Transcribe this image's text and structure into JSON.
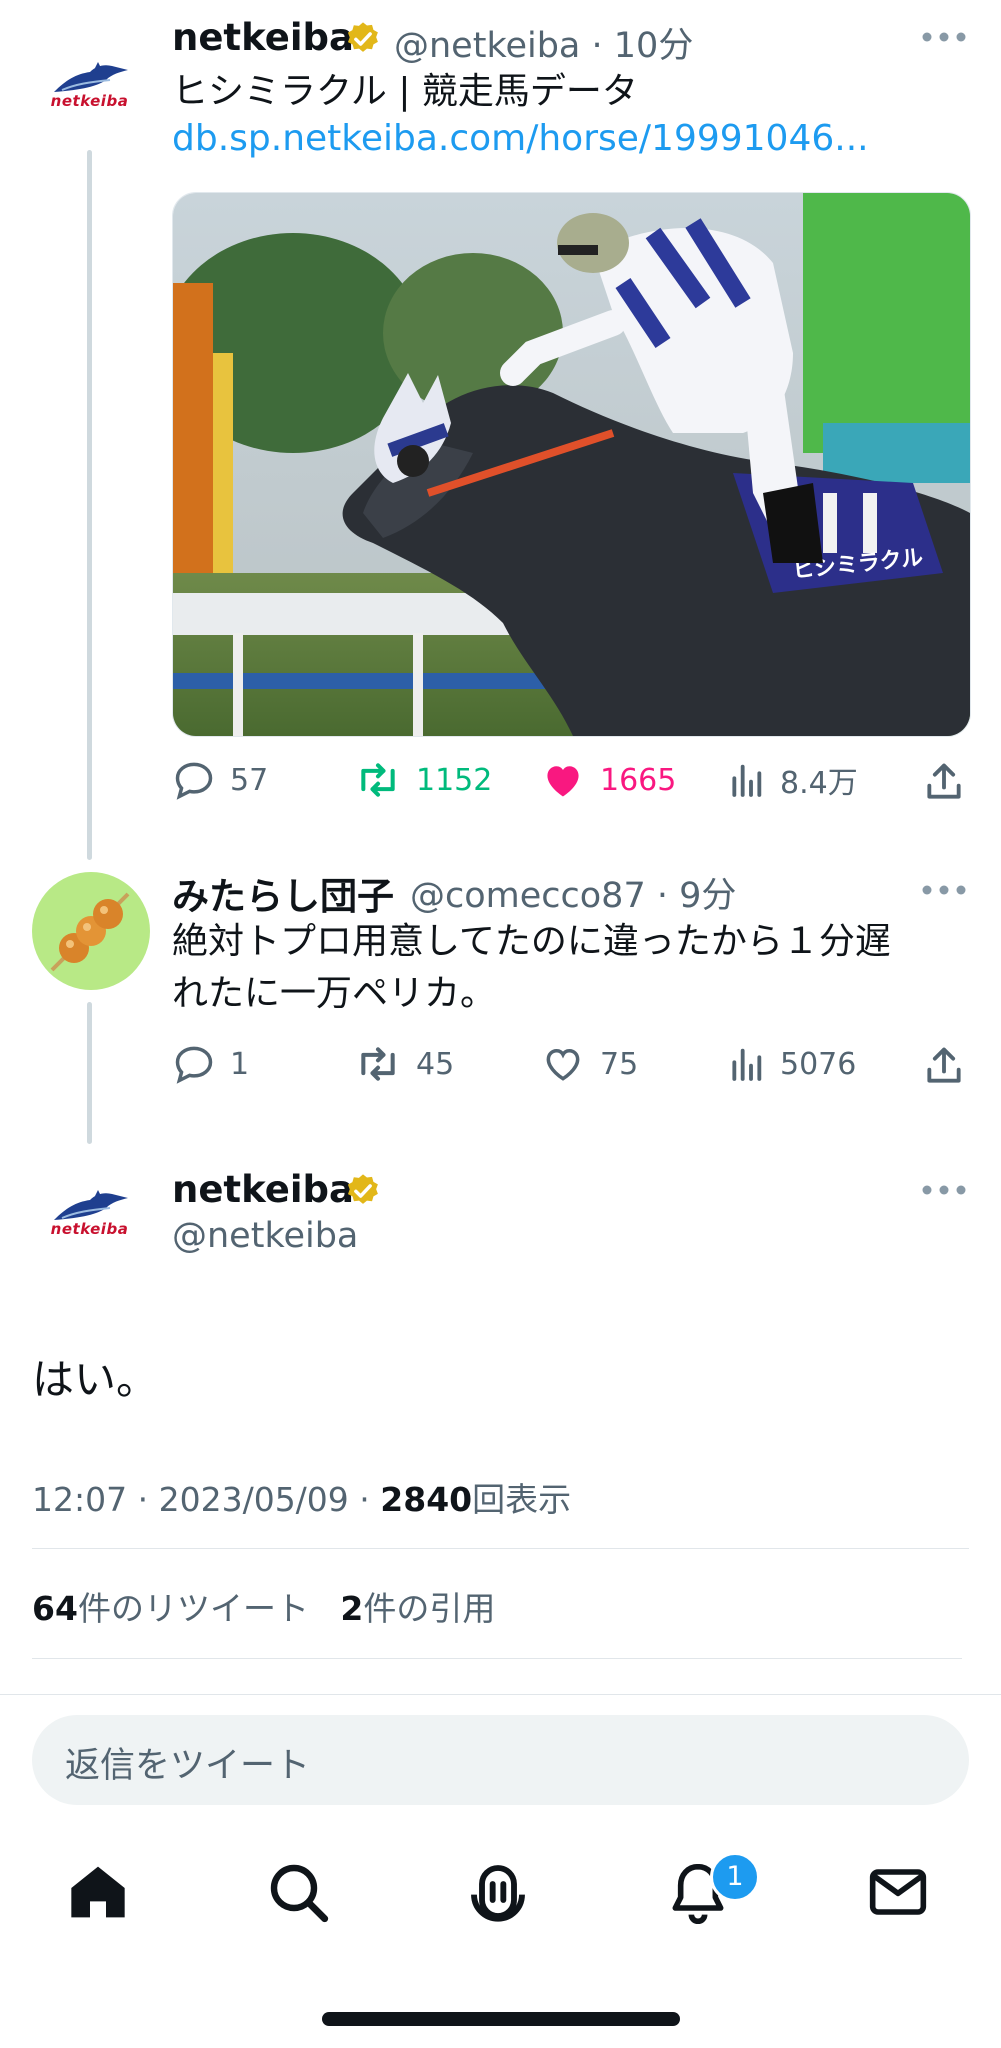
{
  "tweet1": {
    "name": "netkeiba",
    "handle": "@netkeiba",
    "time": "10分",
    "text": "ヒシミラクル | 競走馬データ",
    "link": "db.sp.netkeiba.com/horse/19991046...",
    "avatar_label": "netkeiba",
    "photo_saddle_text": "ヒシミラクル",
    "actions": {
      "replies": "57",
      "retweets": "1152",
      "likes": "1665",
      "views": "8.4万"
    }
  },
  "tweet2": {
    "name": "みたらし団子",
    "handle": "@comecco87",
    "time": "9分",
    "text_line1": "絶対トプロ用意してたのに違ったから１分遅",
    "text_line2": "れたに一万ペリカ。",
    "actions": {
      "replies": "1",
      "retweets": "45",
      "likes": "75",
      "views": "5076"
    }
  },
  "main_tweet": {
    "name": "netkeiba",
    "handle": "@netkeiba",
    "avatar_label": "netkeiba",
    "text": "はい。",
    "time": "12:07",
    "date": "2023/05/09",
    "views_count": "2840",
    "views_label": "回表示",
    "retweet_count": "64",
    "retweet_label": "件のリツイート",
    "quote_count": "2",
    "quote_label": "件の引用"
  },
  "reply": {
    "placeholder": "返信をツイート"
  },
  "nav": {
    "items": [
      "home-icon",
      "search-icon",
      "spaces-icon",
      "notifications-icon",
      "messages-icon"
    ],
    "notification_badge": "1"
  },
  "colors": {
    "accent": "#1d9bf0",
    "retweet_green": "#00ba7c",
    "like_pink": "#f91880",
    "verified_gold": "#e2b719"
  }
}
